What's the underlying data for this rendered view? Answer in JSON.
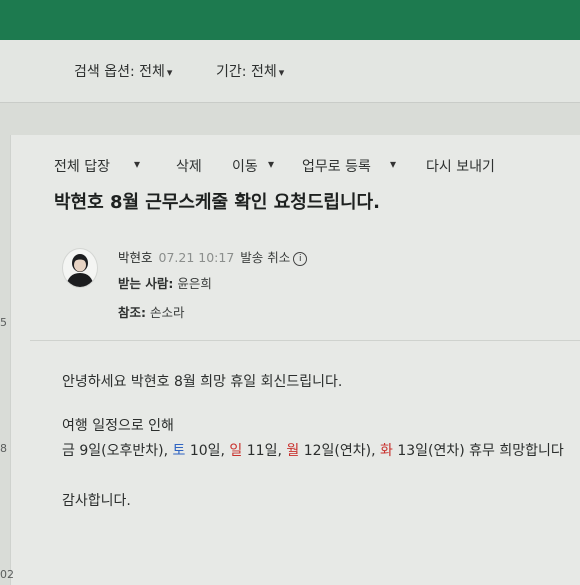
{
  "search": {
    "option_label": "검색 옵션:",
    "option_value": "전체",
    "period_label": "기간:",
    "period_value": "전체"
  },
  "toolbar": {
    "reply_all": "전체 답장",
    "delete": "삭제",
    "move": "이동",
    "register_task": "업무로 등록",
    "resend": "다시 보내기"
  },
  "mail": {
    "subject": "박현호 8월 근무스케줄 확인 요청드립니다.",
    "sender_name": "박현호",
    "sent_time": "07.21 10:17",
    "cancel_send": "발송 취소",
    "to_label": "받는 사람:",
    "to_value": "윤은희",
    "cc_label": "참조:",
    "cc_value": "손소라",
    "body": {
      "greeting": "안녕하세요 박현호 8월 희망 휴일 회신드립니다.",
      "reason": "여행 일정으로 인해",
      "d1": "금",
      "d1_rest": " 9일(오후반차), ",
      "d2": "토",
      "d2_rest": " 10일, ",
      "d3": "일",
      "d3_rest": " 11일, ",
      "d4": "월",
      "d4_rest": " 12일(연차), ",
      "d5": "화",
      "d5_rest": " 13일(연차) 휴무 희망합니다",
      "closing": "감사합니다."
    }
  },
  "gutter": {
    "n1": "5",
    "n2": "8",
    "n3": "02"
  },
  "colors": {
    "top_bar": "#1d7a4f",
    "weekend_red": "#c8302c",
    "saturday_blue": "#2f64c2"
  }
}
